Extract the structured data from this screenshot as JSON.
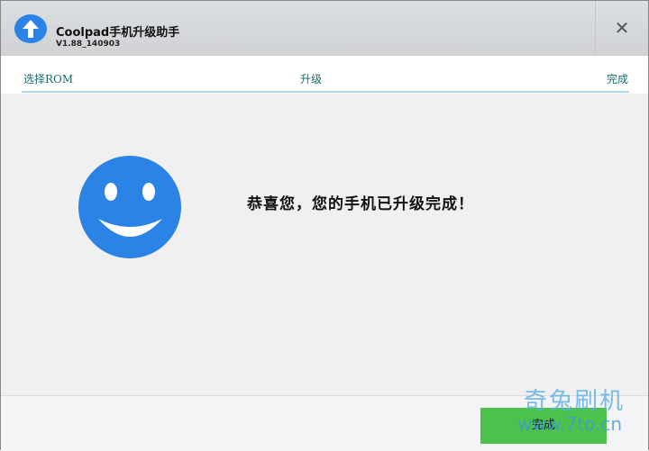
{
  "window": {
    "title": "Coolpad手机升级助手",
    "version": "V1.88_140903",
    "close_icon": "close-icon",
    "app_icon": "upload-arrow-icon"
  },
  "steps": [
    {
      "label": "选择ROM"
    },
    {
      "label": "升级"
    },
    {
      "label": "完成"
    }
  ],
  "main": {
    "icon": "smiley-face-icon",
    "message": "恭喜您，您的手机已升级完成！",
    "accent": "#2b83e6"
  },
  "footer": {
    "finish_label": "完成",
    "button_color": "#4cc24c"
  },
  "watermark": {
    "name": "奇兔刷机",
    "url": "www.7to.cn"
  }
}
